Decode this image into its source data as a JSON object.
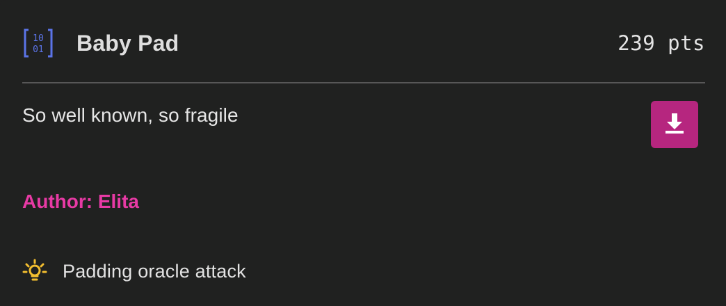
{
  "challenge": {
    "icon": "binary-icon",
    "title": "Baby Pad",
    "points": "239 pts",
    "description": "So well known, so fragile",
    "download_icon": "download-icon",
    "author": "Author: Elita",
    "hint_icon": "lightbulb-icon",
    "hint": "Padding oracle attack"
  },
  "colors": {
    "background": "#202120",
    "accent": "#b6267f",
    "author": "#e83aa5",
    "icon_blue": "#5b74e8",
    "hint_yellow": "#f3be2f"
  }
}
